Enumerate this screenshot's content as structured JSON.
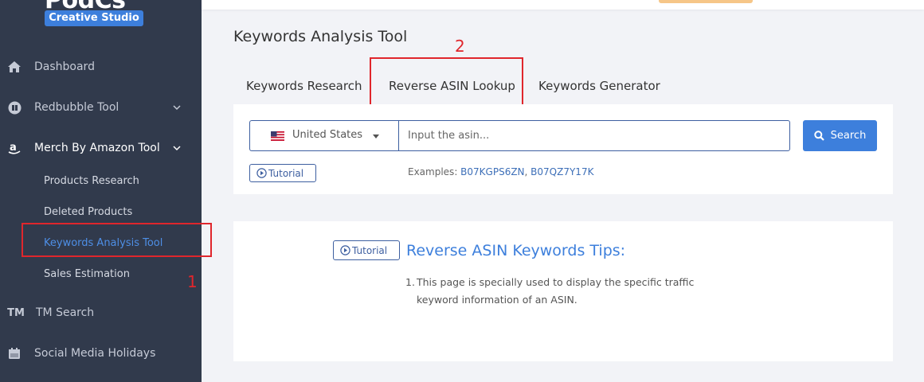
{
  "logo": {
    "name_main": "PodCs",
    "badge": "Creative Studio"
  },
  "sidebar": {
    "items": [
      {
        "label": "Dashboard",
        "icon": "home-icon"
      },
      {
        "label": "Redbubble Tool",
        "icon": "redbubble-icon"
      },
      {
        "label": "Merch By Amazon Tool",
        "icon": "amazon-icon"
      },
      {
        "label": "TM Search",
        "icon": "tm-icon"
      },
      {
        "label": "Social Media Holidays",
        "icon": "calendar-icon"
      }
    ],
    "sub_items": [
      {
        "label": "Products Research"
      },
      {
        "label": "Deleted Products"
      },
      {
        "label": "Keywords Analysis Tool"
      },
      {
        "label": "Sales Estimation"
      }
    ],
    "tm_icon_text": "TM"
  },
  "annotations": {
    "one": "1",
    "two": "2"
  },
  "page": {
    "title": "Keywords Analysis Tool"
  },
  "tabs": [
    {
      "label": "Keywords Research"
    },
    {
      "label": "Reverse ASIN Lookup"
    },
    {
      "label": "Keywords Generator"
    }
  ],
  "search": {
    "country": "United States",
    "placeholder": "Input the asin...",
    "button_label": "Search"
  },
  "tutorial_label": "Tutorial",
  "examples": {
    "prefix": "Examples: ",
    "asin1": "B07KGPS6ZN",
    "separator": ", ",
    "asin2": "B07QZ7Y17K"
  },
  "tips": {
    "title": "Reverse ASIN Keywords Tips:",
    "items": [
      {
        "num": "1.",
        "text": "This page is specially used to display the specific traffic keyword information of an ASIN."
      }
    ]
  },
  "colors": {
    "sidebar_bg": "#313a4c",
    "accent": "#3d7fdc",
    "annotation": "#e0262c"
  }
}
